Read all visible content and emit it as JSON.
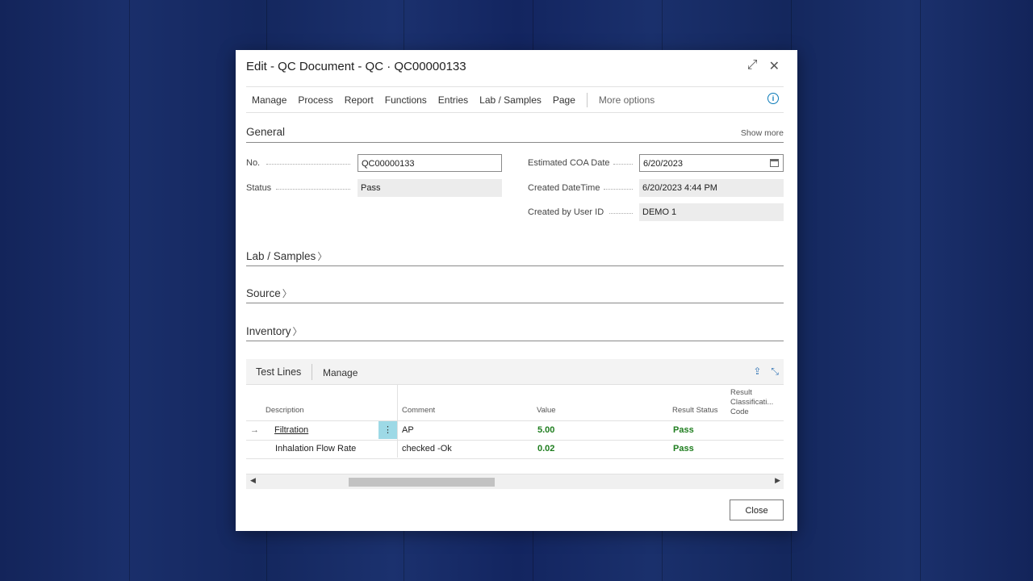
{
  "window": {
    "title": "Edit - QC Document - QC · QC00000133"
  },
  "actions": [
    "Manage",
    "Process",
    "Report",
    "Functions",
    "Entries",
    "Lab / Samples",
    "Page"
  ],
  "more_options": "More options",
  "general": {
    "heading": "General",
    "show_more": "Show more",
    "no_label": "No.",
    "no_value": "QC00000133",
    "status_label": "Status",
    "status_value": "Pass",
    "coa_label": "Estimated COA Date",
    "coa_value": "6/20/2023",
    "created_dt_label": "Created DateTime",
    "created_dt_value": "6/20/2023 4:44 PM",
    "created_by_label": "Created by User ID",
    "created_by_value": "DEMO 1"
  },
  "sections": {
    "lab": "Lab / Samples",
    "source": "Source",
    "inventory": "Inventory"
  },
  "test_lines": {
    "title": "Test Lines",
    "manage": "Manage",
    "headers": {
      "description": "Description",
      "comment": "Comment",
      "value": "Value",
      "result_status": "Result Status",
      "rc1": "Result",
      "rc2": "Classificati...",
      "rc3": "Code"
    },
    "rows": [
      {
        "description": "Filtration",
        "comment": "AP",
        "value": "5.00",
        "status": "Pass"
      },
      {
        "description": "Inhalation Flow Rate",
        "comment": "checked -Ok",
        "value": "0.02",
        "status": "Pass"
      }
    ]
  },
  "buttons": {
    "close": "Close"
  }
}
